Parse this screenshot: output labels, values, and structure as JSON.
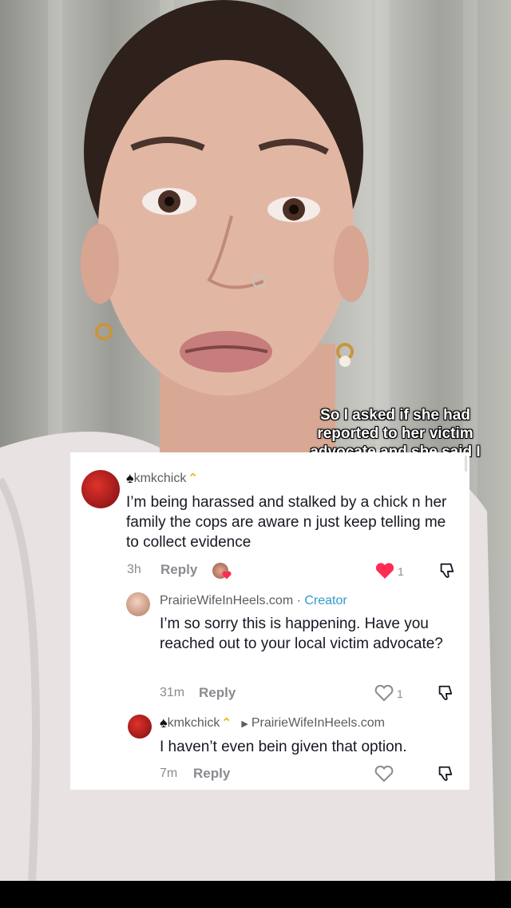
{
  "caption": "So I asked if she had reported to her victim advocate and she said I haven't",
  "comments": [
    {
      "username": "kmkchick",
      "text": "I’m being harassed and stalked by a chick n her family the cops are aware n just keep telling me to collect evidence",
      "time": "3h",
      "reply_label": "Reply",
      "likes": "1",
      "liked": true
    },
    {
      "username": "PrairieWifeInHeels.com",
      "separator": " · ",
      "badge": "Creator",
      "text": "I’m so sorry this is happening. Have you reached out to your local victim advocate?",
      "time": "31m",
      "reply_label": "Reply",
      "likes": "1",
      "liked": false
    },
    {
      "username": "kmkchick",
      "reply_to": "PrairieWifeInHeels.com",
      "text": "I haven’t even bein given that option.",
      "time": "7m",
      "reply_label": "Reply",
      "likes": "",
      "liked": false
    }
  ],
  "colors": {
    "like_red": "#fe2c55",
    "creator_blue": "#2f9bd1",
    "crown_gold": "#f2b71b"
  },
  "icons": [
    "spade-icon",
    "crown-icon",
    "heart-icon",
    "dislike-icon",
    "reply-arrow-icon"
  ]
}
